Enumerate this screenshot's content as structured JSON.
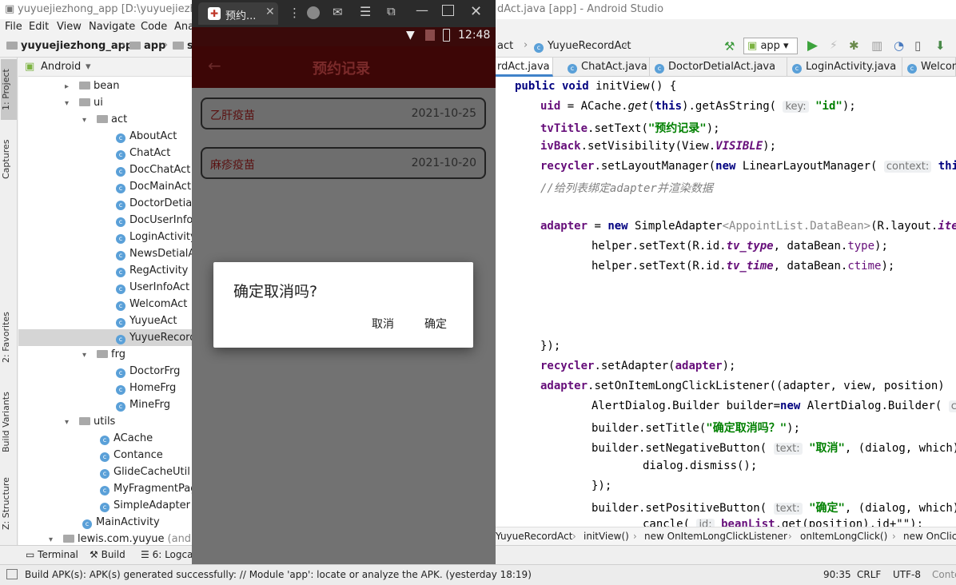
{
  "ide": {
    "window_title_left": "yuyuejiezhong_app [D:\\yuyuejiezhong",
    "window_title_right": "dAct.java [app] - Android Studio",
    "menu": [
      "File",
      "Edit",
      "View",
      "Navigate",
      "Code",
      "Ana"
    ],
    "breadcrumbs": [
      "yuyuejiezhong_app",
      "app",
      "s"
    ],
    "nav_right": {
      "crumb1": "act",
      "crumb2": "YuyueRecordAct",
      "run_config": "app"
    },
    "left_tabs": [
      "1: Project",
      "Captures",
      "2: Favorites",
      "Build Variants",
      "Z: Structure"
    ],
    "project_view": "Android",
    "tree": [
      {
        "label": "bean",
        "kind": "folder",
        "depth": 2,
        "arrow": "▸"
      },
      {
        "label": "ui",
        "kind": "folder",
        "depth": 2,
        "arrow": "▾"
      },
      {
        "label": "act",
        "kind": "folder",
        "depth": 3,
        "arrow": "▾"
      },
      {
        "label": "AboutAct",
        "kind": "class",
        "depth": 4
      },
      {
        "label": "ChatAct",
        "kind": "class",
        "depth": 4
      },
      {
        "label": "DocChatAct",
        "kind": "class",
        "depth": 4
      },
      {
        "label": "DocMainActiv",
        "kind": "class",
        "depth": 4
      },
      {
        "label": "DoctorDetialA",
        "kind": "class",
        "depth": 4
      },
      {
        "label": "DocUserInfoA",
        "kind": "class",
        "depth": 4
      },
      {
        "label": "LoginActivity",
        "kind": "class",
        "depth": 4
      },
      {
        "label": "NewsDetialAc",
        "kind": "class",
        "depth": 4
      },
      {
        "label": "RegActivity",
        "kind": "class",
        "depth": 4
      },
      {
        "label": "UserInfoAct",
        "kind": "class",
        "depth": 4
      },
      {
        "label": "WelcomAct",
        "kind": "class",
        "depth": 4
      },
      {
        "label": "YuyueAct",
        "kind": "class",
        "depth": 4
      },
      {
        "label": "YuyueRecordA",
        "kind": "class",
        "depth": 4,
        "selected": true
      },
      {
        "label": "frg",
        "kind": "folder",
        "depth": 3,
        "arrow": "▾"
      },
      {
        "label": "DoctorFrg",
        "kind": "class",
        "depth": 4
      },
      {
        "label": "HomeFrg",
        "kind": "class",
        "depth": 4
      },
      {
        "label": "MineFrg",
        "kind": "class",
        "depth": 4
      },
      {
        "label": "utils",
        "kind": "folder",
        "depth": 2,
        "arrow": "▾"
      },
      {
        "label": "ACache",
        "kind": "class",
        "depth": 3
      },
      {
        "label": "Contance",
        "kind": "class",
        "depth": 3
      },
      {
        "label": "GlideCacheUtil",
        "kind": "class",
        "depth": 3
      },
      {
        "label": "MyFragmentPage",
        "kind": "class",
        "depth": 3
      },
      {
        "label": "SimpleAdapter",
        "kind": "class",
        "depth": 3
      },
      {
        "label": "MainActivity",
        "kind": "class",
        "depth": 2
      },
      {
        "label": "lewis.com.yuyue",
        "kind": "folder",
        "depth": 1,
        "arrow": "▾",
        "suffix": "(androi"
      }
    ],
    "editor_tabs": [
      "rdAct.java",
      "ChatAct.java",
      "DoctorDetialAct.java",
      "LoginActivity.java",
      "Welcom"
    ],
    "code_crumbs": [
      "YuyueRecordAct",
      "initView()",
      "new OnItemLongClickListener",
      "onItemLongClick()",
      "new OnClic"
    ],
    "bottom_tools": [
      "Terminal",
      "Build",
      "6: Logcat"
    ],
    "status_message": "Build APK(s): APK(s) generated successfully: // Module 'app': locate or analyze the APK. (yesterday 18:19)",
    "status_right": {
      "pos": "90:35",
      "eol": "CRLF",
      "enc": "UTF-8",
      "extra": "Conte"
    }
  },
  "emulator": {
    "tab_title": "预约...",
    "time": "12:48",
    "app_title": "预约记录",
    "records": [
      {
        "type": "乙肝疫苗",
        "date": "2021-10-25"
      },
      {
        "type": "麻疹疫苗",
        "date": "2021-10-20"
      }
    ],
    "dialog": {
      "title": "确定取消吗?",
      "negative": "取消",
      "positive": "确定"
    }
  },
  "colors": {
    "accent": "#4083c9",
    "app_bar": "#3d0606",
    "dialog_bg": "#ffffff"
  }
}
